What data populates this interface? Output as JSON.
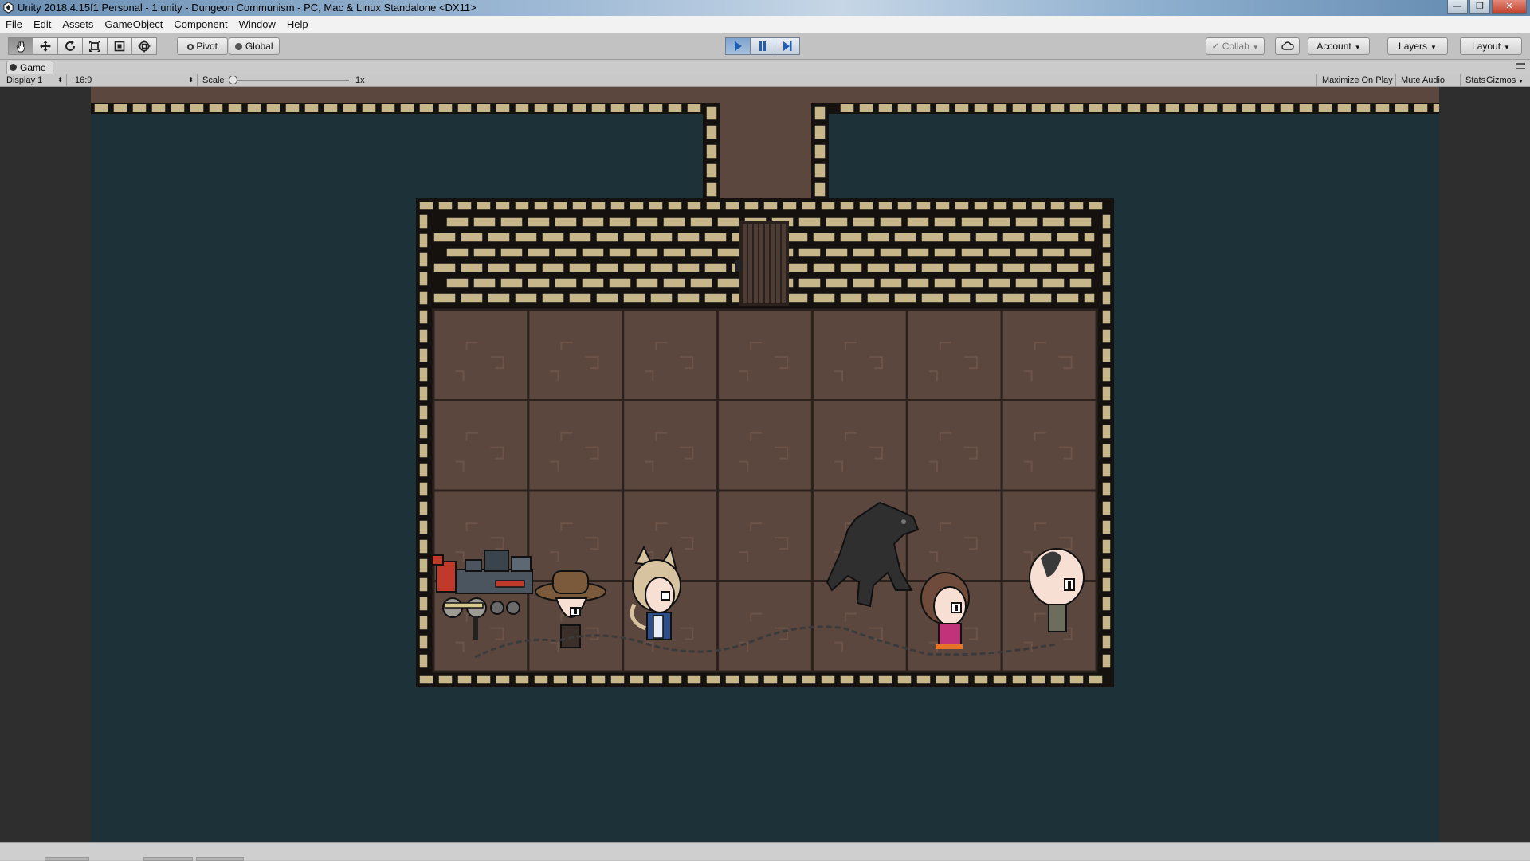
{
  "window": {
    "title": "Unity 2018.4.15f1 Personal - 1.unity - Dungeon Communism - PC, Mac & Linux Standalone <DX11>",
    "buttons": {
      "minimize": "—",
      "maximize": "❐",
      "close": "✕"
    }
  },
  "menu": [
    "File",
    "Edit",
    "Assets",
    "GameObject",
    "Component",
    "Window",
    "Help"
  ],
  "toolbar": {
    "tools": [
      "hand-icon",
      "move-icon",
      "rotate-icon",
      "scale-icon",
      "rect-tool-icon",
      "transform-icon"
    ],
    "pivot_label": "Pivot",
    "global_label": "Global",
    "play_icons": [
      "play-icon",
      "pause-icon",
      "step-icon"
    ],
    "collab_label": "Collab",
    "account_label": "Account",
    "layers_label": "Layers",
    "layout_label": "Layout"
  },
  "game_tab": {
    "label": "Game"
  },
  "game_options": {
    "display": "Display 1",
    "aspect": "16:9",
    "scale_label": "Scale",
    "scale_value": "1x",
    "maximize_on_play": "Maximize On Play",
    "mute_audio": "Mute Audio",
    "stats": "Stats",
    "gizmos": "Gizmos"
  },
  "colors": {
    "game_background": "#1d3138",
    "floor": "#5c473f",
    "stone": "#c7b68a",
    "play_active": "#7fa4cf"
  }
}
